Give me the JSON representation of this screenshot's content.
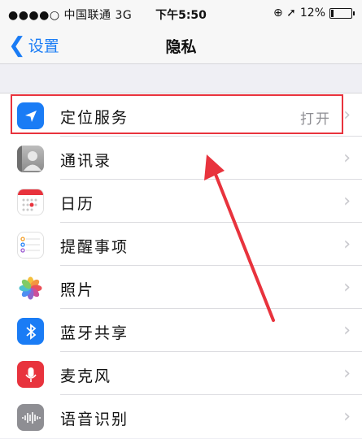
{
  "status": {
    "carrier": "●●●●○ 中国联通  3G",
    "time": "下午5:50",
    "icons": "⊕ ➚",
    "battery_text": "12%",
    "battery_level": 0.12
  },
  "nav": {
    "back_label": "设置",
    "title": "隐私"
  },
  "rows": [
    {
      "label": "定位服务",
      "value": "打开",
      "icon": "location-arrow-icon",
      "color": "#1a7cf5"
    },
    {
      "label": "通讯录",
      "value": "",
      "icon": "contacts-icon",
      "color": "#9a9a9a"
    },
    {
      "label": "日历",
      "value": "",
      "icon": "calendar-icon",
      "color": "#ffffff"
    },
    {
      "label": "提醒事项",
      "value": "",
      "icon": "reminders-icon",
      "color": "#ffffff"
    },
    {
      "label": "照片",
      "value": "",
      "icon": "photos-icon",
      "color": "#ffffff"
    },
    {
      "label": "蓝牙共享",
      "value": "",
      "icon": "bluetooth-icon",
      "color": "#1a7cf5"
    },
    {
      "label": "麦克风",
      "value": "",
      "icon": "microphone-icon",
      "color": "#e8333d"
    },
    {
      "label": "语音识别",
      "value": "",
      "icon": "speech-recognition-icon",
      "color": "#8e8e93"
    }
  ],
  "chevron": "›"
}
